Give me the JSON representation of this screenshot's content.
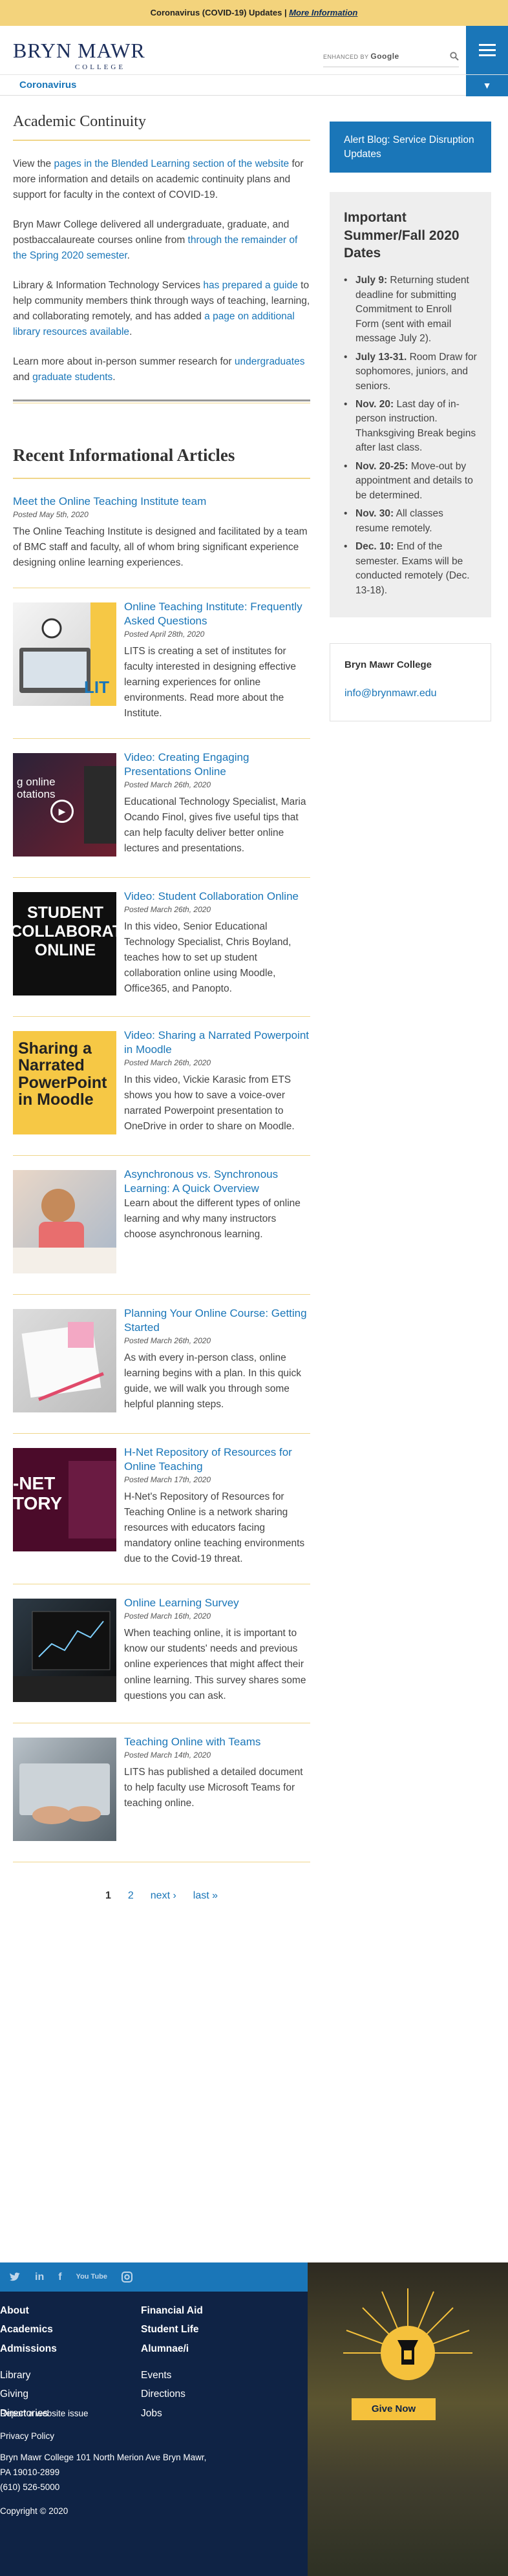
{
  "alert": {
    "text": "Coronavirus (COVID-19) Updates |",
    "link": "More Information"
  },
  "header": {
    "logo_main": "BRYN MAWR",
    "logo_sub": "COLLEGE",
    "search_placeholder": "ENHANCED BY",
    "search_brand": "Google",
    "subnav_label": "Coronavirus"
  },
  "page": {
    "title": "Academic Continuity",
    "intro": {
      "p1_pre": "View the ",
      "p1_link": "pages in the Blended Learning section of the website",
      "p1_post": " for more information and details on academic continuity plans and support for faculty in the context of COVID-19.",
      "p2_pre": "Bryn Mawr College delivered all undergraduate, graduate, and postbaccalaureate courses online from ",
      "p2_link": "through the remainder of the Spring 2020 semester",
      "p2_post": ".",
      "p3_pre": "Library & Information Technology Services ",
      "p3_link1": "has prepared a guide",
      "p3_mid": " to help community members think through ways of teaching, learning, and collaborating remotely, and has added ",
      "p3_link2": "a page on additional library resources available",
      "p3_post": ".",
      "p4_pre": "Learn more about in-person summer research for ",
      "p4_link1": "undergraduates",
      "p4_mid": " and ",
      "p4_link2": "graduate students",
      "p4_post": "."
    },
    "recent_title": "Recent Informational Articles"
  },
  "articles": [
    {
      "title": "Meet the Online Teaching Institute team",
      "date": "Posted May 5th, 2020",
      "body": "The Online Teaching Institute is designed and facilitated by a team of BMC staff and faculty, all of whom bring significant experience designing online learning experiences.",
      "thumb_text": ""
    },
    {
      "title": "Online Teaching Institute: Frequently Asked Questions",
      "date": "Posted April 28th, 2020",
      "body": "LITS is creating a set of institutes for faculty interested in designing effective learning experiences for online environments. Read more about the Institute.",
      "thumb_text": "LIT"
    },
    {
      "title": "Video: Creating Engaging Presentations Online",
      "date": "Posted March 26th, 2020",
      "body": "Educational Technology Specialist, Maria Ocando Finol, gives five useful tips that can help faculty deliver better online lectures and presentations.",
      "thumb_text": "g online otations"
    },
    {
      "title": "Video: Student Collaboration Online",
      "date": "Posted March 26th, 2020",
      "body": "In this video, Senior Educational Technology Specialist, Chris Boyland, teaches how to set up student collaboration online using Moodle, Office365, and Panopto.",
      "thumb_text": "STUDENT COLLABORATIO ONLINE"
    },
    {
      "title": "Video: Sharing a Narrated Powerpoint in Moodle",
      "date": "Posted March 26th, 2020",
      "body": "In this video, Vickie Karasic from ETS shows you how to save a voice-over narrated Powerpoint presentation to OneDrive in order to share on Moodle.",
      "thumb_text": "Sharing a Narrated PowerPoint in Moodle"
    },
    {
      "title": "Asynchronous vs. Synchronous Learning: A Quick Overview",
      "date": "",
      "body": "Learn about the different types of online learning and why many instructors choose asynchronous learning.",
      "thumb_text": ""
    },
    {
      "title": "Planning Your Online Course: Getting Started",
      "date": "Posted March 26th, 2020",
      "body": "As with every in-person class, online learning begins with a plan. In this quick guide, we will walk you through some helpful planning steps.",
      "thumb_text": ""
    },
    {
      "title": "H-Net Repository of Resources for Online Teaching",
      "date": "Posted March 17th, 2020",
      "body": "H-Net's Repository of Resources for Teaching Online is a network sharing resources with educators facing mandatory online teaching environments due to the Covid-19 threat.",
      "thumb_text": "-NET TORY"
    },
    {
      "title": "Online Learning Survey",
      "date": "Posted March 16th, 2020",
      "body": "When teaching online, it is important to know our students' needs and previous online experiences that might affect their online learning. This survey shares some questions you can ask.",
      "thumb_text": ""
    },
    {
      "title": "Teaching Online with Teams",
      "date": "Posted March 14th, 2020",
      "body": "LITS has published a detailed document to help faculty use Microsoft Teams for teaching online.",
      "thumb_text": ""
    }
  ],
  "pager": {
    "current": "1",
    "page2": "2",
    "next": "next ›",
    "last": "last »"
  },
  "sidebar": {
    "alert_button": "Alert Blog: Service Disruption Updates",
    "dates_title": "Important Summer/Fall 2020 Dates",
    "dates": [
      {
        "date": "July 9:",
        "text": " Returning student deadline for submitting Commitment to Enroll Form (sent with email message July 2)."
      },
      {
        "date": "July 13-31.",
        "text": " Room Draw for sophomores, juniors, and seniors."
      },
      {
        "date": "Nov. 20:",
        "text": " Last day of in-person instruction. Thanksgiving Break begins after last class."
      },
      {
        "date": "Nov. 20-25:",
        "text": " Move-out by appointment and details to be determined."
      },
      {
        "date": "Nov. 30:",
        "text": " All classes resume remotely."
      },
      {
        "date": "Dec. 10:",
        "text": " End of the semester. Exams will be conducted remotely (Dec. 13-18)."
      }
    ],
    "contact_name": "Bryn Mawr College",
    "contact_email": "info@brynmawr.edu"
  },
  "footer": {
    "social": [
      "twitter-icon",
      "linkedin-icon",
      "facebook-icon",
      "youtube-icon",
      "instagram-icon"
    ],
    "social_labels": {
      "in": "in",
      "f": "f",
      "yt": "You Tube"
    },
    "col1_bold": [
      "About",
      "Academics",
      "Admissions"
    ],
    "col2_bold": [
      "Financial Aid",
      "Student Life",
      "Alumnae/i"
    ],
    "col1": [
      "Library",
      "Giving",
      "Directories"
    ],
    "col2": [
      "Events",
      "Directions",
      "Jobs"
    ],
    "report": "Report a website issue",
    "privacy": "Privacy Policy",
    "address1": "Bryn Mawr College 101 North Merion Ave Bryn Mawr,",
    "address2": "PA 19010-2899",
    "phone": "(610) 526-5000",
    "copyright": "Copyright © 2020",
    "give_now": "Give Now"
  },
  "colors": {
    "brand_blue": "#1a76b8",
    "navy": "#0f2345",
    "gold": "#f3d37c"
  }
}
